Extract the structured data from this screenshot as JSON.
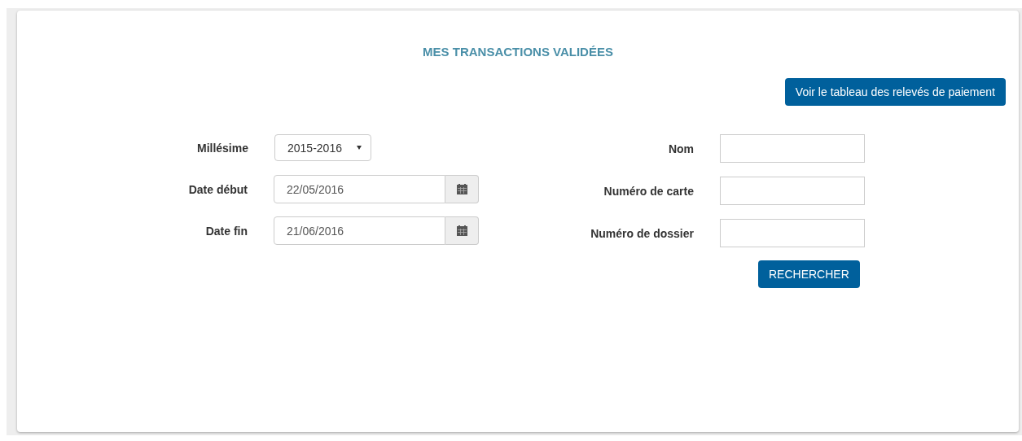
{
  "title": "MES TRANSACTIONS VALIDÉES",
  "statements_button": "Voir le tableau des relevés de paiement",
  "left_fields": [
    {
      "kind": "select",
      "label": "Millésime",
      "value": "2015-2016"
    },
    {
      "kind": "date",
      "label": "Date début",
      "value": "22/05/2016"
    },
    {
      "kind": "date",
      "label": "Date fin",
      "value": "21/06/2016"
    }
  ],
  "right_fields": [
    {
      "kind": "text",
      "label": "Nom"
    },
    {
      "kind": "text",
      "label": "Numéro de carte"
    },
    {
      "kind": "text",
      "label": "Numéro de dossier"
    }
  ],
  "search_button": "RECHERCHER"
}
